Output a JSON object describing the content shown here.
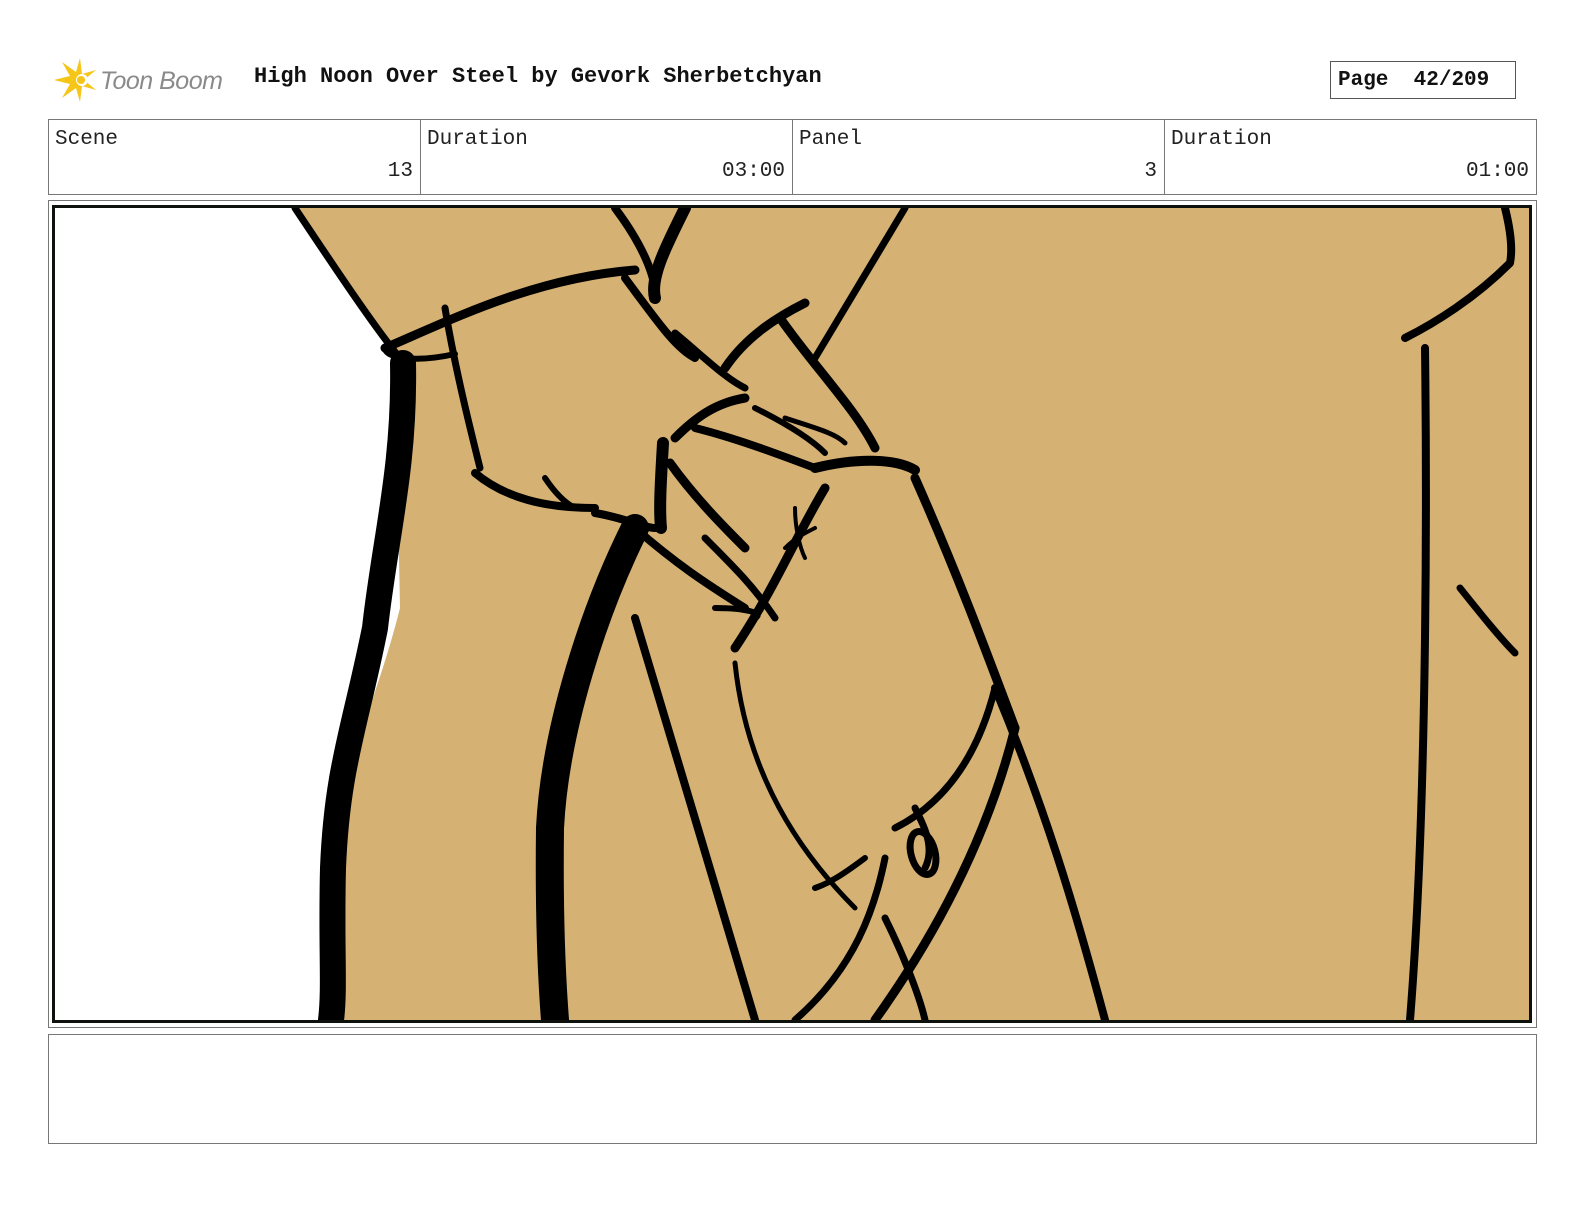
{
  "header": {
    "logo_text": "Toon Boom",
    "title": "High Noon Over Steel by Gevork Sherbetchyan",
    "page_label": "Page",
    "page_value": "42/209"
  },
  "info": {
    "scene_label": "Scene",
    "scene_value": "13",
    "scene_duration_label": "Duration",
    "scene_duration_value": "03:00",
    "panel_label": "Panel",
    "panel_value": "3",
    "panel_duration_label": "Duration",
    "panel_duration_value": "01:00"
  },
  "panel_art": {
    "background_color": "#d5b174",
    "line_color": "#000000",
    "frame_color": "#0d130c"
  },
  "notes": {
    "text": ""
  }
}
